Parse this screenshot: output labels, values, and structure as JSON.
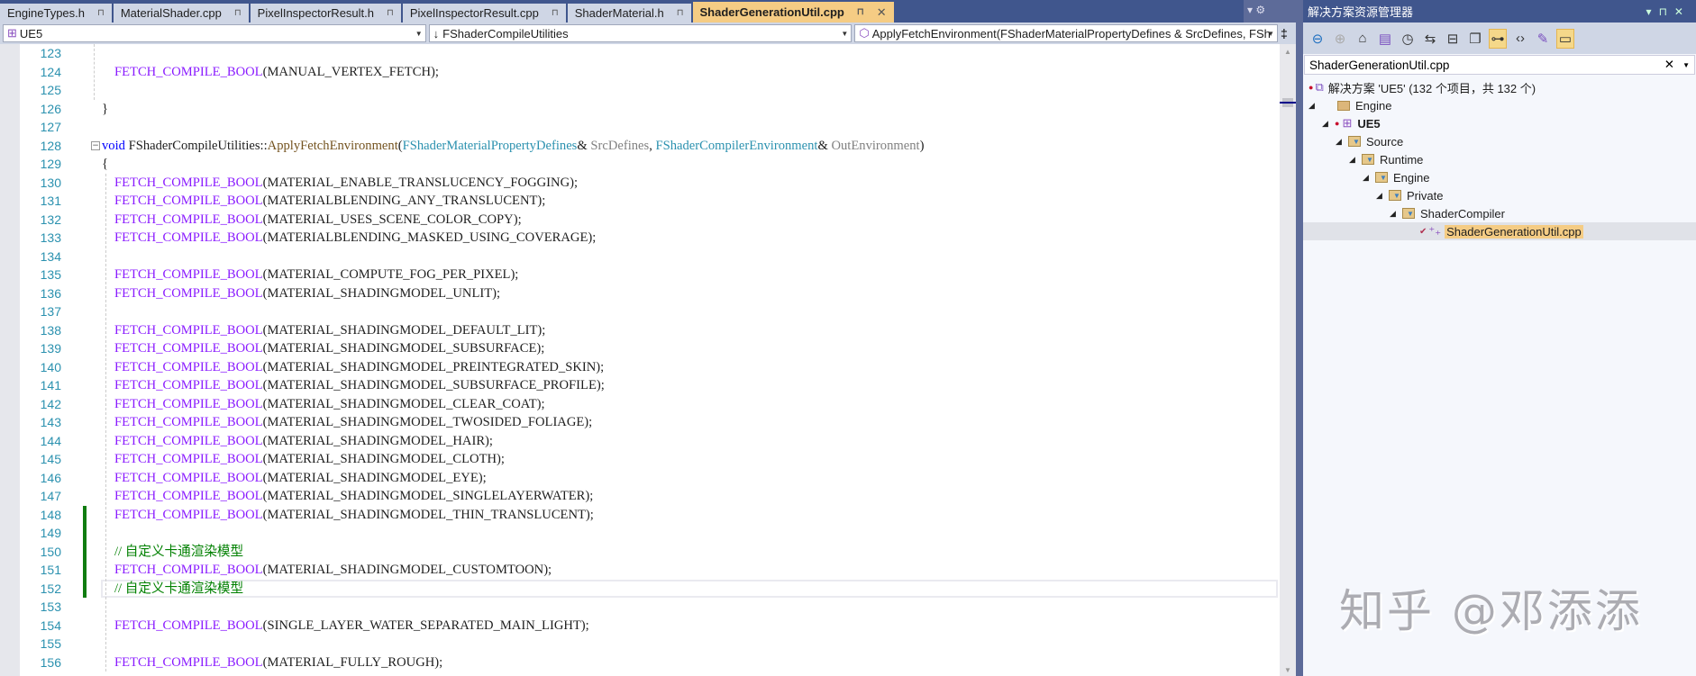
{
  "tabs": [
    {
      "label": "EngineTypes.h",
      "pinned": true
    },
    {
      "label": "MaterialShader.cpp",
      "pinned": true
    },
    {
      "label": "PixelInspectorResult.h",
      "pinned": true
    },
    {
      "label": "PixelInspectorResult.cpp",
      "pinned": true
    },
    {
      "label": "ShaderMaterial.h",
      "pinned": true
    },
    {
      "label": "ShaderGenerationUtil.cpp",
      "pinned": true,
      "active": true
    }
  ],
  "navbar": {
    "project": "UE5",
    "scope": "FShaderCompileUtilities",
    "member": "ApplyFetchEnvironment(FShaderMaterialPropertyDefines & SrcDefines, FSh"
  },
  "editor": {
    "current_line": 152,
    "changed_lines": [
      148,
      149,
      150,
      151,
      152
    ],
    "lines": [
      {
        "n": "123",
        "indent": 0,
        "tokens": []
      },
      {
        "n": "124",
        "indent": 1,
        "tokens": [
          [
            "mac",
            "FETCH_COMPILE_BOOL"
          ],
          [
            "pl",
            "(MANUAL_VERTEX_FETCH);"
          ]
        ]
      },
      {
        "n": "125",
        "indent": 0,
        "tokens": []
      },
      {
        "n": "126",
        "indent": 0,
        "tokens": [
          [
            "pl",
            "}"
          ]
        ]
      },
      {
        "n": "127",
        "indent": 0,
        "tokens": []
      },
      {
        "n": "128",
        "indent": 0,
        "tokens": [
          [
            "kw",
            "void"
          ],
          [
            "pl",
            " FShaderCompileUtilities::"
          ],
          [
            "fn",
            "ApplyFetchEnvironment"
          ],
          [
            "pl",
            "("
          ],
          [
            "ty",
            "FShaderMaterialPropertyDefines"
          ],
          [
            "pl",
            "& "
          ],
          [
            "pm",
            "SrcDefines"
          ],
          [
            "pl",
            ", "
          ],
          [
            "ty",
            "FShaderCompilerEnvironment"
          ],
          [
            "pl",
            "& "
          ],
          [
            "pm",
            "OutEnvironment"
          ],
          [
            "pl",
            ")"
          ]
        ]
      },
      {
        "n": "129",
        "indent": 0,
        "tokens": [
          [
            "pl",
            "{"
          ]
        ]
      },
      {
        "n": "130",
        "indent": 1,
        "tokens": [
          [
            "mac",
            "FETCH_COMPILE_BOOL"
          ],
          [
            "pl",
            "(MATERIAL_ENABLE_TRANSLUCENCY_FOGGING);"
          ]
        ]
      },
      {
        "n": "131",
        "indent": 1,
        "tokens": [
          [
            "mac",
            "FETCH_COMPILE_BOOL"
          ],
          [
            "pl",
            "(MATERIALBLENDING_ANY_TRANSLUCENT);"
          ]
        ]
      },
      {
        "n": "132",
        "indent": 1,
        "tokens": [
          [
            "mac",
            "FETCH_COMPILE_BOOL"
          ],
          [
            "pl",
            "(MATERIAL_USES_SCENE_COLOR_COPY);"
          ]
        ]
      },
      {
        "n": "133",
        "indent": 1,
        "tokens": [
          [
            "mac",
            "FETCH_COMPILE_BOOL"
          ],
          [
            "pl",
            "(MATERIALBLENDING_MASKED_USING_COVERAGE);"
          ]
        ]
      },
      {
        "n": "134",
        "indent": 0,
        "tokens": []
      },
      {
        "n": "135",
        "indent": 1,
        "tokens": [
          [
            "mac",
            "FETCH_COMPILE_BOOL"
          ],
          [
            "pl",
            "(MATERIAL_COMPUTE_FOG_PER_PIXEL);"
          ]
        ]
      },
      {
        "n": "136",
        "indent": 1,
        "tokens": [
          [
            "mac",
            "FETCH_COMPILE_BOOL"
          ],
          [
            "pl",
            "(MATERIAL_SHADINGMODEL_UNLIT);"
          ]
        ]
      },
      {
        "n": "137",
        "indent": 0,
        "tokens": []
      },
      {
        "n": "138",
        "indent": 1,
        "tokens": [
          [
            "mac",
            "FETCH_COMPILE_BOOL"
          ],
          [
            "pl",
            "(MATERIAL_SHADINGMODEL_DEFAULT_LIT);"
          ]
        ]
      },
      {
        "n": "139",
        "indent": 1,
        "tokens": [
          [
            "mac",
            "FETCH_COMPILE_BOOL"
          ],
          [
            "pl",
            "(MATERIAL_SHADINGMODEL_SUBSURFACE);"
          ]
        ]
      },
      {
        "n": "140",
        "indent": 1,
        "tokens": [
          [
            "mac",
            "FETCH_COMPILE_BOOL"
          ],
          [
            "pl",
            "(MATERIAL_SHADINGMODEL_PREINTEGRATED_SKIN);"
          ]
        ]
      },
      {
        "n": "141",
        "indent": 1,
        "tokens": [
          [
            "mac",
            "FETCH_COMPILE_BOOL"
          ],
          [
            "pl",
            "(MATERIAL_SHADINGMODEL_SUBSURFACE_PROFILE);"
          ]
        ]
      },
      {
        "n": "142",
        "indent": 1,
        "tokens": [
          [
            "mac",
            "FETCH_COMPILE_BOOL"
          ],
          [
            "pl",
            "(MATERIAL_SHADINGMODEL_CLEAR_COAT);"
          ]
        ]
      },
      {
        "n": "143",
        "indent": 1,
        "tokens": [
          [
            "mac",
            "FETCH_COMPILE_BOOL"
          ],
          [
            "pl",
            "(MATERIAL_SHADINGMODEL_TWOSIDED_FOLIAGE);"
          ]
        ]
      },
      {
        "n": "144",
        "indent": 1,
        "tokens": [
          [
            "mac",
            "FETCH_COMPILE_BOOL"
          ],
          [
            "pl",
            "(MATERIAL_SHADINGMODEL_HAIR);"
          ]
        ]
      },
      {
        "n": "145",
        "indent": 1,
        "tokens": [
          [
            "mac",
            "FETCH_COMPILE_BOOL"
          ],
          [
            "pl",
            "(MATERIAL_SHADINGMODEL_CLOTH);"
          ]
        ]
      },
      {
        "n": "146",
        "indent": 1,
        "tokens": [
          [
            "mac",
            "FETCH_COMPILE_BOOL"
          ],
          [
            "pl",
            "(MATERIAL_SHADINGMODEL_EYE);"
          ]
        ]
      },
      {
        "n": "147",
        "indent": 1,
        "tokens": [
          [
            "mac",
            "FETCH_COMPILE_BOOL"
          ],
          [
            "pl",
            "(MATERIAL_SHADINGMODEL_SINGLELAYERWATER);"
          ]
        ]
      },
      {
        "n": "148",
        "indent": 1,
        "tokens": [
          [
            "mac",
            "FETCH_COMPILE_BOOL"
          ],
          [
            "pl",
            "(MATERIAL_SHADINGMODEL_THIN_TRANSLUCENT);"
          ]
        ]
      },
      {
        "n": "149",
        "indent": 0,
        "tokens": []
      },
      {
        "n": "150",
        "indent": 1,
        "tokens": [
          [
            "cm",
            "// 自定义卡通渲染模型"
          ]
        ]
      },
      {
        "n": "151",
        "indent": 1,
        "tokens": [
          [
            "mac",
            "FETCH_COMPILE_BOOL"
          ],
          [
            "pl",
            "(MATERIAL_SHADINGMODEL_CUSTOMTOON);"
          ]
        ]
      },
      {
        "n": "152",
        "indent": 1,
        "tokens": [
          [
            "cm",
            "// 自定义卡通渲染模型"
          ]
        ]
      },
      {
        "n": "153",
        "indent": 0,
        "tokens": []
      },
      {
        "n": "154",
        "indent": 1,
        "tokens": [
          [
            "mac",
            "FETCH_COMPILE_BOOL"
          ],
          [
            "pl",
            "(SINGLE_LAYER_WATER_SEPARATED_MAIN_LIGHT);"
          ]
        ]
      },
      {
        "n": "155",
        "indent": 0,
        "tokens": []
      },
      {
        "n": "156",
        "indent": 1,
        "tokens": [
          [
            "mac",
            "FETCH_COMPILE_BOOL"
          ],
          [
            "pl",
            "(MATERIAL_FULLY_ROUGH);"
          ]
        ]
      }
    ]
  },
  "solution_explorer": {
    "title": "解决方案资源管理器",
    "search_value": "ShaderGenerationUtil.cpp",
    "tree": [
      {
        "label": "解决方案 'UE5' (132 个项目，共 132 个)",
        "level": 0,
        "icon": "solution-icon"
      },
      {
        "label": "Engine",
        "level": 1,
        "icon": "folder-icon",
        "expanded": true
      },
      {
        "label": "UE5",
        "level": 2,
        "icon": "project-icon",
        "expanded": true,
        "bold": true
      },
      {
        "label": "Source",
        "level": 3,
        "icon": "filter-folder-icon",
        "expanded": true
      },
      {
        "label": "Runtime",
        "level": 4,
        "icon": "filter-folder-icon",
        "expanded": true
      },
      {
        "label": "Engine",
        "level": 5,
        "icon": "filter-folder-icon",
        "expanded": true
      },
      {
        "label": "Private",
        "level": 6,
        "icon": "filter-folder-icon",
        "expanded": true
      },
      {
        "label": "ShaderCompiler",
        "level": 7,
        "icon": "filter-folder-icon",
        "expanded": true
      },
      {
        "label": "ShaderGenerationUtil.cpp",
        "level": 8,
        "icon": "cpp-file-icon",
        "selected": true
      }
    ]
  },
  "watermark": "知乎 @邓添添",
  "colors": {
    "accent_tab": "#f5cc84",
    "title_bar": "#40568d",
    "macro": "#8a1bff",
    "comment": "#008000",
    "keyword": "#0000ff",
    "type": "#2b91af",
    "change_bar": "#107c10"
  }
}
